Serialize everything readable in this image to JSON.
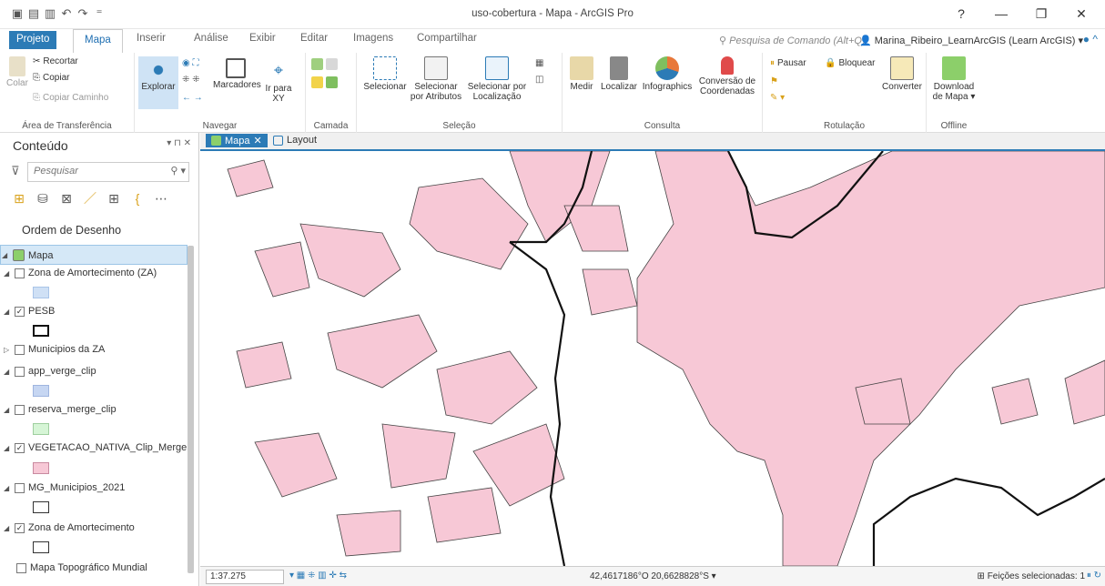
{
  "window": {
    "title": "uso-cobertura - Mapa - ArcGIS Pro",
    "help": "?",
    "minimize": "—",
    "restore": "❐",
    "close": "✕"
  },
  "tabs": [
    "Projeto",
    "Mapa",
    "Inserir",
    "Análise",
    "Exibir",
    "Editar",
    "Imagens",
    "Compartilhar"
  ],
  "command_search": "Pesquisa de Comando (Alt+Q)",
  "user": "Marina_Ribeiro_LearnArcGIS (Learn ArcGIS)",
  "ribbon": {
    "clipboard": {
      "label": "Área de Transferência",
      "colar": "Colar",
      "recortar": "Recortar",
      "copiar": "Copiar",
      "copiar_caminho": "Copiar Caminho"
    },
    "navegar": {
      "label": "Navegar",
      "explorar": "Explorar",
      "marcadores": "Marcadores",
      "ir_para": "Ir para",
      "xy": "XY"
    },
    "camada": {
      "label": "Camada"
    },
    "selecao": {
      "label": "Seleção",
      "selecionar": "Selecionar",
      "por_atributos_1": "Selecionar",
      "por_atributos_2": "por Atributos",
      "por_localizacao_1": "Selecionar por",
      "por_localizacao_2": "Localização"
    },
    "consulta": {
      "label": "Consulta",
      "medir": "Medir",
      "localizar": "Localizar",
      "infographics": "Infographics",
      "conversao_1": "Conversão de",
      "conversao_2": "Coordenadas"
    },
    "rotulacao": {
      "label": "Rotulação",
      "pausar": "Pausar",
      "bloquear": "Bloquear",
      "converter": "Converter"
    },
    "offline": {
      "label": "Offline",
      "download_1": "Download",
      "download_2": "de Mapa ▾"
    }
  },
  "contents": {
    "title": "Conteúdo",
    "search_placeholder": "Pesquisar",
    "draw_order": "Ordem de Desenho",
    "map_name": "Mapa",
    "layers": [
      {
        "name": "Zona de Amortecimento (ZA)",
        "checked": false,
        "symbol": "#cfe0f5"
      },
      {
        "name": "PESB",
        "checked": true,
        "symbol": "#ffffff"
      },
      {
        "name": "Municipios da ZA",
        "checked": false,
        "symbol": ""
      },
      {
        "name": "app_verge_clip",
        "checked": false,
        "symbol": "#c6d6f2"
      },
      {
        "name": "reserva_merge_clip",
        "checked": false,
        "symbol": "#d6f5d6"
      },
      {
        "name": "VEGETACAO_NATIVA_Clip_Merge",
        "checked": true,
        "symbol": "#f7c8d6"
      },
      {
        "name": "MG_Municipios_2021",
        "checked": false,
        "symbol": "#ffffff"
      },
      {
        "name": "Zona de Amortecimento",
        "checked": true,
        "symbol": "#ffffff"
      },
      {
        "name": "Mapa Topográfico Mundial",
        "checked": false,
        "symbol": ""
      }
    ]
  },
  "map_tabs": [
    "Mapa",
    "Layout"
  ],
  "status": {
    "scale": "1:37.275",
    "coords": "42,4617186°O 20,6628828°S",
    "selected_label": "Feições selecionadas:",
    "selected_count": "1"
  },
  "colors": {
    "vegetation": "#f7c8d6",
    "vegetation_stroke": "#444444",
    "boundary": "#111111",
    "accent": "#2c7bb6"
  }
}
